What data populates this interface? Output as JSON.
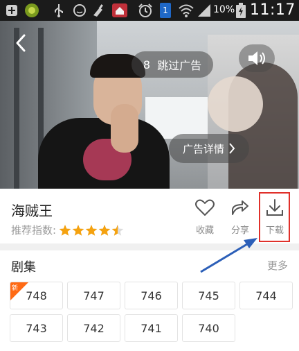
{
  "status_bar": {
    "battery_percent": "10%",
    "time": "11:17",
    "notification_badge": "1",
    "icons": [
      "plus-icon",
      "android-icon",
      "usb-icon",
      "emoticon-icon",
      "clean-icon",
      "shield-app-icon",
      "alarm-icon",
      "notification-icon",
      "wifi-icon",
      "signal-icon",
      "battery-icon"
    ]
  },
  "player": {
    "skip_ad_count": "8",
    "skip_ad_label": "跳过广告",
    "ad_details_label": "广告详情"
  },
  "show": {
    "title": "海贼王",
    "rating_label": "推荐指数:",
    "rating_stars": 4.5
  },
  "actions": {
    "favorite": "收藏",
    "share": "分享",
    "download": "下载"
  },
  "episodes": {
    "title": "剧集",
    "more": "更多",
    "new_badge": "新",
    "items": [
      "748",
      "747",
      "746",
      "745",
      "744",
      "743",
      "742",
      "741",
      "740"
    ]
  },
  "colors": {
    "accent": "#f5a20f",
    "highlight": "#e0302a",
    "new_badge": "#ff6a14",
    "arrow": "#2c5fb8"
  }
}
